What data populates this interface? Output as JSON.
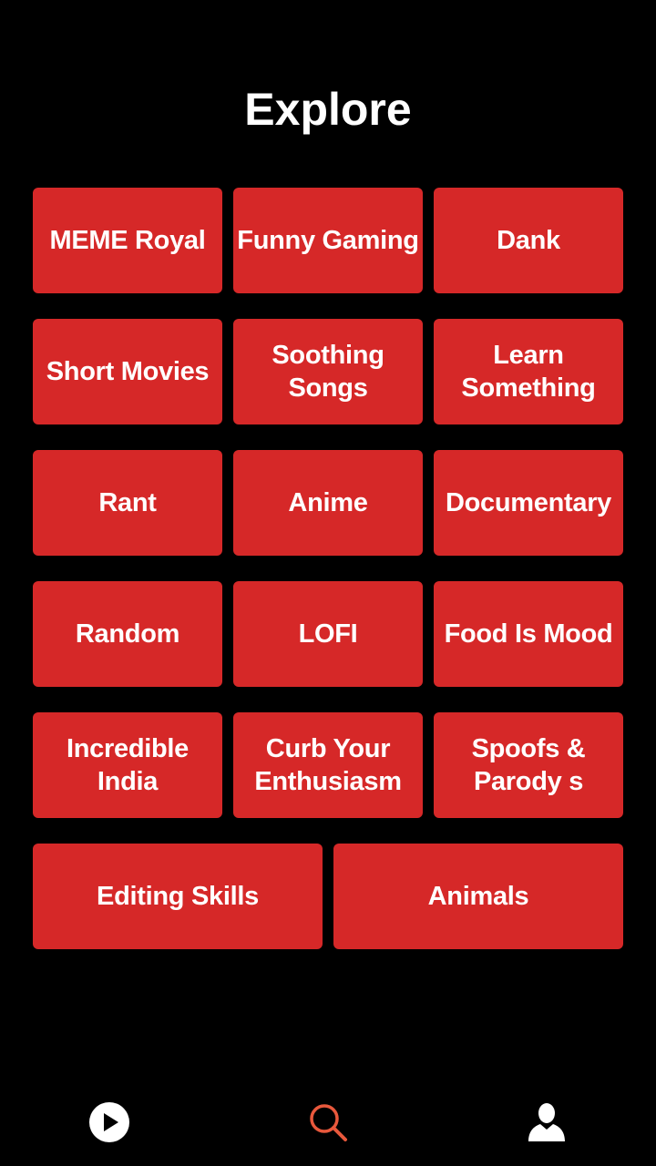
{
  "page": {
    "title": "Explore"
  },
  "categories": [
    {
      "label": "MEME Royal"
    },
    {
      "label": "Funny Gaming"
    },
    {
      "label": "Dank"
    },
    {
      "label": "Short Movies"
    },
    {
      "label": "Soothing Songs"
    },
    {
      "label": "Learn Something"
    },
    {
      "label": "Rant"
    },
    {
      "label": "Anime"
    },
    {
      "label": "Documentary"
    },
    {
      "label": "Random"
    },
    {
      "label": "LOFI"
    },
    {
      "label": "Food Is Mood"
    },
    {
      "label": "Incredible India"
    },
    {
      "label": "Curb Your Enthusiasm"
    },
    {
      "label": "Spoofs & Parody s"
    },
    {
      "label": "Editing Skills"
    },
    {
      "label": "Animals"
    }
  ],
  "bottom_nav": {
    "items": [
      {
        "icon": "play-icon",
        "active": false
      },
      {
        "icon": "search-icon",
        "active": true
      },
      {
        "icon": "profile-icon",
        "active": false
      }
    ]
  },
  "colors": {
    "background": "#000000",
    "tile": "#d62828",
    "text": "#ffffff",
    "active_icon": "#e8583c"
  }
}
